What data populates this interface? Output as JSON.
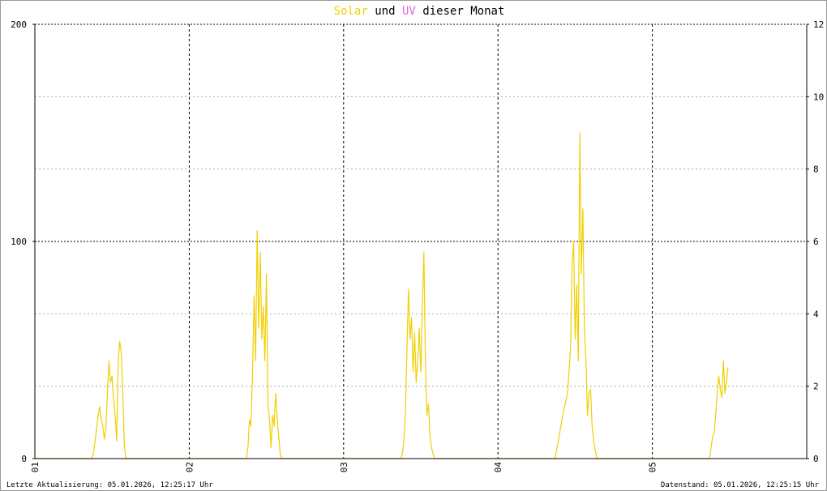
{
  "title": {
    "word1": "Solar",
    "word2": " und ",
    "word3": "UV",
    "word4": " dieser Monat"
  },
  "footer": {
    "left": "Letzte Aktualisierung: 05.01.2026, 12:25:17 Uhr",
    "right": "Datenstand: 05.01.2026, 12:25:15 Uhr"
  },
  "colors": {
    "solar": "#f0d000",
    "uv": "#dd66dd",
    "grid_major": "#000000",
    "grid_minor": "#aaaaaa"
  },
  "chart_data": {
    "type": "line",
    "title": "Solar und UV dieser Monat",
    "x_ticks": [
      "01",
      "02",
      "03",
      "04",
      "05"
    ],
    "xlim_days": [
      1,
      6
    ],
    "y_left": {
      "lim": [
        0,
        200
      ],
      "ticks": [
        "0",
        "100",
        "200"
      ]
    },
    "y_right": {
      "lim": [
        0,
        12
      ],
      "ticks": [
        "0",
        "2",
        "4",
        "6",
        "8",
        "10",
        "12"
      ]
    },
    "grid": true,
    "series": [
      {
        "name": "Solar",
        "axis": "left",
        "points": [
          [
            1.0,
            0
          ],
          [
            1.37,
            0
          ],
          [
            1.38,
            3
          ],
          [
            1.39,
            8
          ],
          [
            1.4,
            14
          ],
          [
            1.41,
            20
          ],
          [
            1.42,
            24
          ],
          [
            1.43,
            18
          ],
          [
            1.44,
            15
          ],
          [
            1.45,
            9
          ],
          [
            1.46,
            14
          ],
          [
            1.47,
            30
          ],
          [
            1.48,
            45
          ],
          [
            1.49,
            35
          ],
          [
            1.5,
            38
          ],
          [
            1.51,
            27
          ],
          [
            1.52,
            20
          ],
          [
            1.53,
            8
          ],
          [
            1.54,
            45
          ],
          [
            1.55,
            54
          ],
          [
            1.56,
            48
          ],
          [
            1.57,
            30
          ],
          [
            1.58,
            6
          ],
          [
            1.59,
            0
          ],
          [
            2.37,
            0
          ],
          [
            2.38,
            5
          ],
          [
            2.39,
            18
          ],
          [
            2.4,
            15
          ],
          [
            2.41,
            40
          ],
          [
            2.42,
            75
          ],
          [
            2.43,
            45
          ],
          [
            2.44,
            105
          ],
          [
            2.45,
            60
          ],
          [
            2.46,
            95
          ],
          [
            2.47,
            55
          ],
          [
            2.48,
            70
          ],
          [
            2.49,
            45
          ],
          [
            2.5,
            85
          ],
          [
            2.51,
            25
          ],
          [
            2.52,
            18
          ],
          [
            2.53,
            5
          ],
          [
            2.54,
            20
          ],
          [
            2.55,
            15
          ],
          [
            2.56,
            30
          ],
          [
            2.57,
            18
          ],
          [
            2.58,
            10
          ],
          [
            2.59,
            2
          ],
          [
            2.6,
            0
          ],
          [
            3.37,
            0
          ],
          [
            3.38,
            2
          ],
          [
            3.39,
            8
          ],
          [
            3.4,
            20
          ],
          [
            3.41,
            50
          ],
          [
            3.42,
            78
          ],
          [
            3.43,
            55
          ],
          [
            3.44,
            65
          ],
          [
            3.45,
            40
          ],
          [
            3.46,
            58
          ],
          [
            3.47,
            35
          ],
          [
            3.48,
            45
          ],
          [
            3.49,
            60
          ],
          [
            3.5,
            40
          ],
          [
            3.51,
            70
          ],
          [
            3.52,
            95
          ],
          [
            3.53,
            45
          ],
          [
            3.54,
            20
          ],
          [
            3.55,
            25
          ],
          [
            3.56,
            10
          ],
          [
            3.57,
            5
          ],
          [
            3.58,
            2
          ],
          [
            3.59,
            0
          ],
          [
            4.37,
            0
          ],
          [
            4.39,
            8
          ],
          [
            4.42,
            20
          ],
          [
            4.45,
            30
          ],
          [
            4.47,
            50
          ],
          [
            4.48,
            90
          ],
          [
            4.49,
            100
          ],
          [
            4.5,
            55
          ],
          [
            4.51,
            80
          ],
          [
            4.52,
            45
          ],
          [
            4.53,
            150
          ],
          [
            4.54,
            85
          ],
          [
            4.55,
            115
          ],
          [
            4.56,
            60
          ],
          [
            4.57,
            45
          ],
          [
            4.58,
            20
          ],
          [
            4.59,
            30
          ],
          [
            4.6,
            32
          ],
          [
            4.61,
            15
          ],
          [
            4.62,
            8
          ],
          [
            4.63,
            4
          ],
          [
            4.64,
            0
          ],
          [
            5.37,
            0
          ],
          [
            5.38,
            5
          ],
          [
            5.39,
            10
          ],
          [
            5.4,
            12
          ],
          [
            5.41,
            20
          ],
          [
            5.42,
            30
          ],
          [
            5.43,
            38
          ],
          [
            5.44,
            32
          ],
          [
            5.45,
            28
          ],
          [
            5.46,
            45
          ],
          [
            5.47,
            30
          ],
          [
            5.48,
            35
          ],
          [
            5.49,
            42
          ]
        ]
      }
    ]
  }
}
